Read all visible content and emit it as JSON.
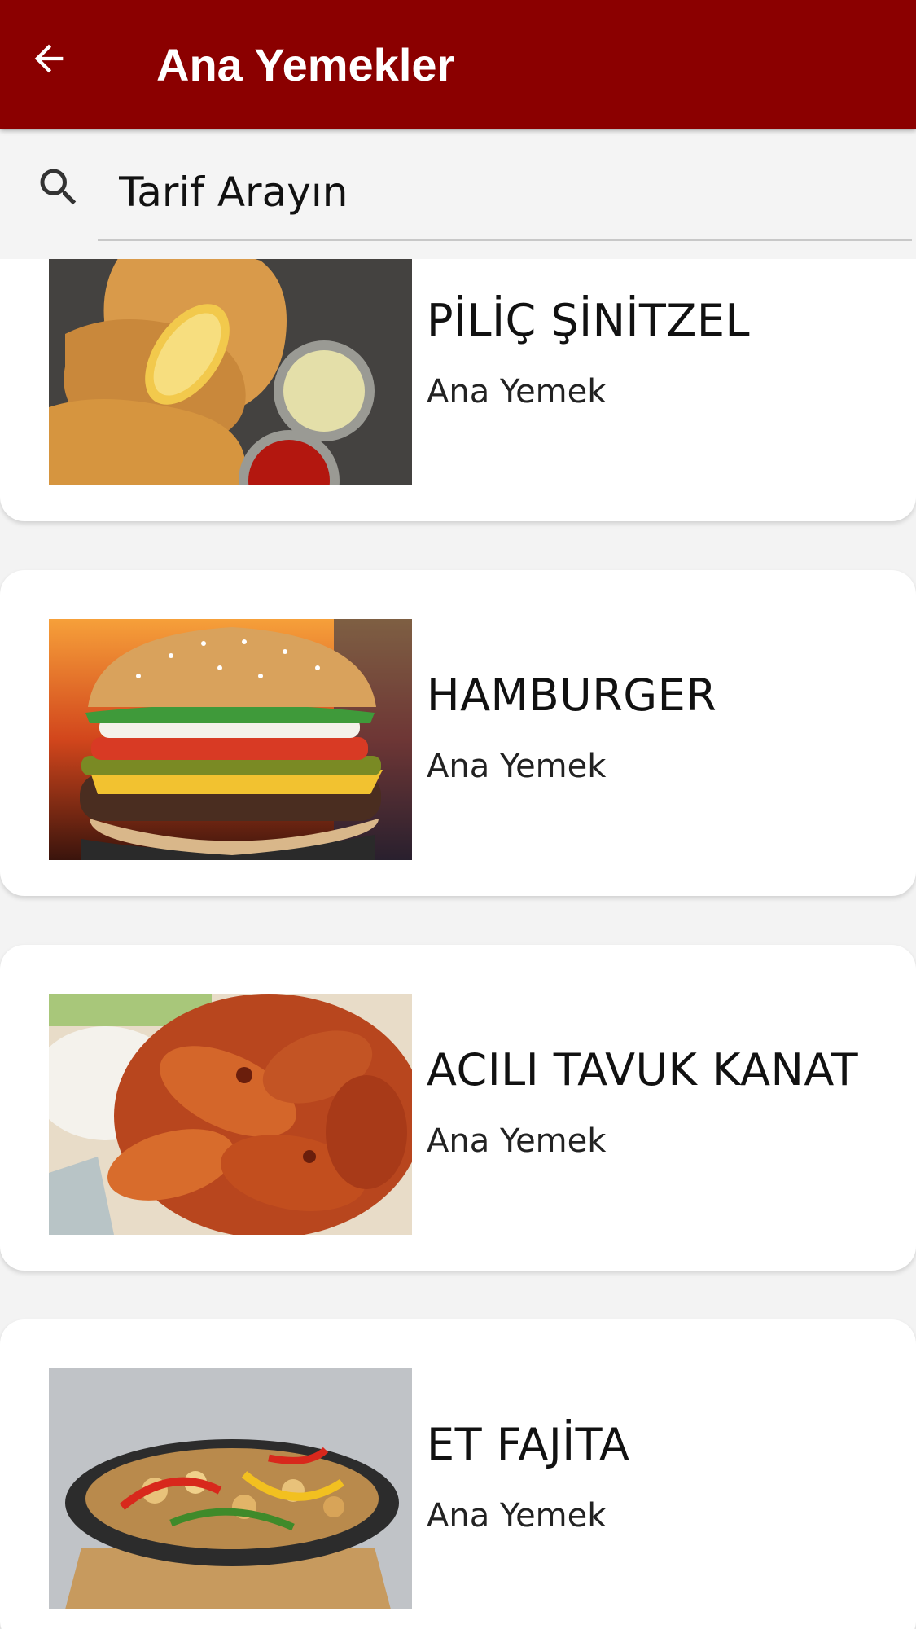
{
  "appbar": {
    "title": "Ana Yemekler",
    "back_icon": "arrow-left-icon",
    "color": "#8b0000"
  },
  "search": {
    "placeholder": "Tarif Arayın",
    "icon": "search-icon"
  },
  "recipes": [
    {
      "name": "PİLİÇ ŞİNİTZEL",
      "category": "Ana Yemek",
      "image": "chicken-schnitzel-photo"
    },
    {
      "name": "HAMBURGER",
      "category": "Ana Yemek",
      "image": "hamburger-photo"
    },
    {
      "name": "ACILI TAVUK KANAT",
      "category": "Ana Yemek",
      "image": "spicy-chicken-wings-photo"
    },
    {
      "name": "ET FAJİTA",
      "category": "Ana Yemek",
      "image": "beef-fajita-photo"
    }
  ]
}
